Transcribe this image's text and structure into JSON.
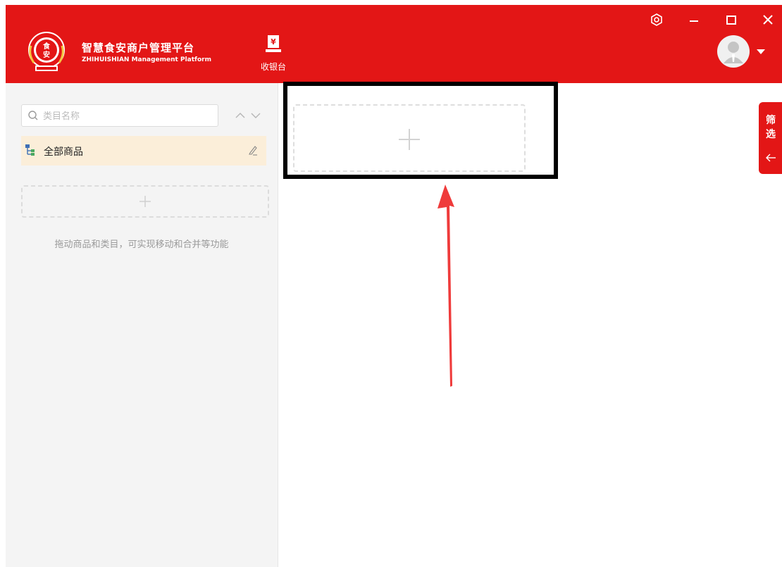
{
  "app": {
    "title": "智慧食安商户管理平台",
    "subtitle": "ZHIHUISHIAN Management Platform",
    "logo_text": "食安"
  },
  "toolbar": {
    "cashier_label": "收银台"
  },
  "window_controls": [
    "settings-icon",
    "minimize-icon",
    "maximize-icon",
    "close-icon"
  ],
  "sidebar": {
    "search_placeholder": "类目名称",
    "selected_category": "全部商品",
    "hint": "拖动商品和类目，可实现移动和合并等功能"
  },
  "filter_tab": {
    "label": "筛选"
  },
  "colors": {
    "brand_red": "#e31616",
    "selected_row": "#fbeed9",
    "sidebar_bg": "#f4f4f4"
  }
}
